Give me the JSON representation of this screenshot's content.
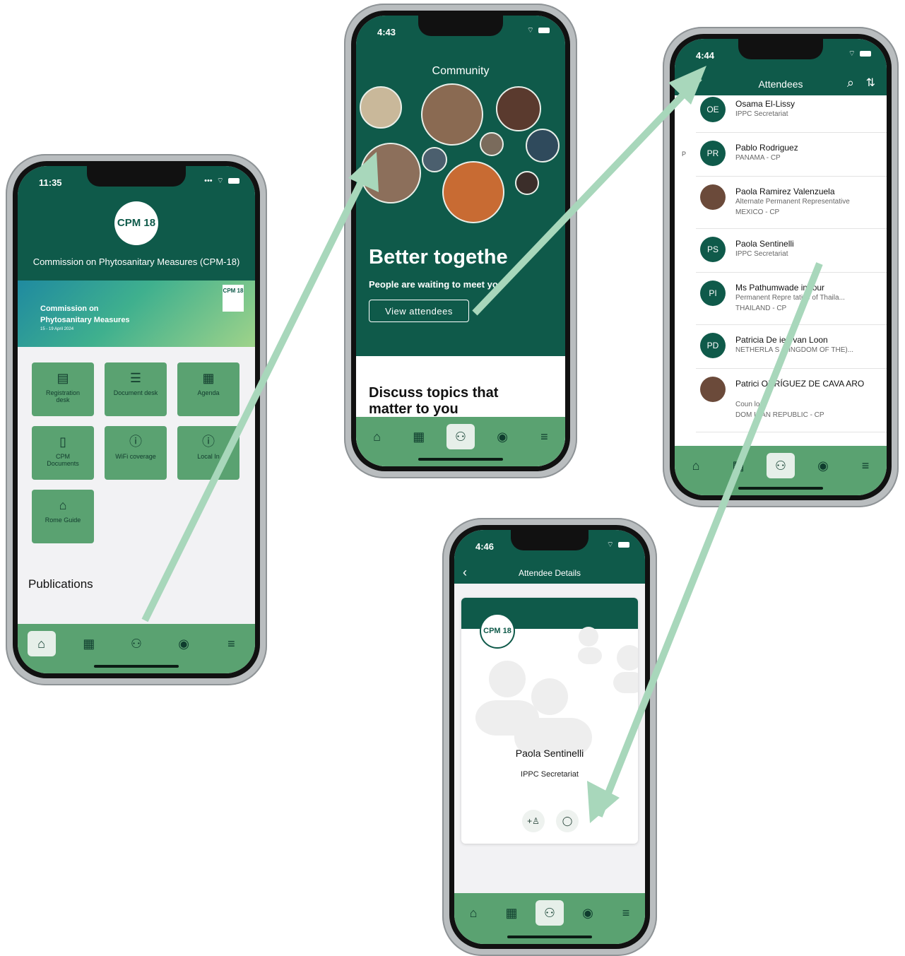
{
  "colors": {
    "brand_dark": "#0f5a4a",
    "brand_mid": "#5aa271",
    "tile": "#5aa271",
    "arrow": "#a8d7bb"
  },
  "phone1": {
    "time": "11:35",
    "logo": "CPM 18",
    "title": "Commission on Phytosanitary Measures (CPM-18)",
    "banner": {
      "line1": "Commission on",
      "line2": "Phytosanitary Measures",
      "dates": "15 - 19 April 2024",
      "badge": "CPM 18"
    },
    "tiles": [
      {
        "label": "Registration desk",
        "icon": "id-card-icon"
      },
      {
        "label": "Document desk",
        "icon": "document-icon"
      },
      {
        "label": "Agenda",
        "icon": "calendar-grid-icon"
      },
      {
        "label": "CPM Documents",
        "icon": "file-icon"
      },
      {
        "label": "WiFi coverage",
        "icon": "info-icon"
      },
      {
        "label": "Local In",
        "icon": "info-icon"
      },
      {
        "label": "Rome Guide",
        "icon": "building-icon"
      }
    ],
    "section": "Publications"
  },
  "phone2": {
    "time": "4:43",
    "header": "Community",
    "headline": "Better togethe",
    "subtitle": "People are waiting to meet yo",
    "button": "View attendees",
    "discuss": "Discuss topics that matter to you"
  },
  "phone3": {
    "time": "4:44",
    "header": "Attendees",
    "index_letter": "P",
    "attendees": [
      {
        "initials": "OE",
        "name": "Osama El-Lissy",
        "line1": "IPPC Secretariat",
        "line2": ""
      },
      {
        "initials": "PR",
        "name": "Pablo Rodriguez",
        "line1": "PANAMA - CP",
        "line2": ""
      },
      {
        "initials": "",
        "name": "Paola Ramirez Valenzuela",
        "line1": "Alternate Permanent Representative",
        "line2": "MEXICO - CP"
      },
      {
        "initials": "PS",
        "name": "Paola Sentinelli",
        "line1": "IPPC Secretariat",
        "line2": ""
      },
      {
        "initials": "PI",
        "name": "Ms Pathumwade imtour",
        "line1": "Permanent Repre tative of Thaila...",
        "line2": "THAILAND - CP"
      },
      {
        "initials": "PD",
        "name": "Patricia De ies-van Loon",
        "line1": "NETHERLA S (KINGDOM OF THE)...",
        "line2": ""
      },
      {
        "initials": "",
        "name": "Patrici ODRÍGUEZ DE CAVA ARO",
        "line1": "Coun lor",
        "line2": "DOM ICAN REPUBLIC - CP"
      }
    ]
  },
  "phone4": {
    "time": "4:46",
    "header": "Attendee Details",
    "logo": "CPM 18",
    "name": "Paola Sentinelli",
    "org": "IPPC Secretariat"
  }
}
